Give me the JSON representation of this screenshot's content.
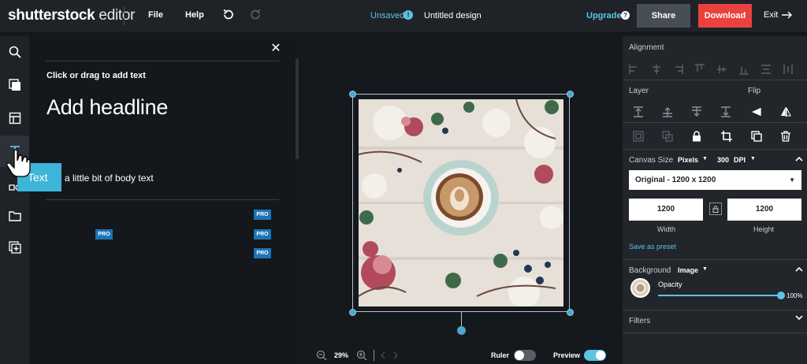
{
  "app": {
    "logo_brand": "shutterstock",
    "logo_product": "editor"
  },
  "topbar": {
    "file_label": "File",
    "help_label": "Help",
    "status_label": "Unsaved",
    "design_name": "Untitled design",
    "upgrade_label": "Upgrade",
    "share_label": "Share",
    "download_label": "Download",
    "exit_label": "Exit"
  },
  "rail": {
    "items": [
      "search-icon",
      "templates-icon",
      "layout-icon",
      "text-icon",
      "elements-icon",
      "folder-icon",
      "add-image-icon"
    ],
    "active": "text-icon"
  },
  "text_panel": {
    "hint": "Click or drag to add text",
    "headline": "Add headline",
    "body": "a little bit of body text",
    "tooltip": "Text",
    "pro_badge": "PRO"
  },
  "canvas": {
    "zoom": "29%",
    "ruler_label": "Ruler",
    "ruler_on": false,
    "preview_label": "Preview",
    "preview_on": true
  },
  "properties": {
    "alignment_title": "Alignment",
    "layer_title": "Layer",
    "flip_title": "Flip",
    "canvas_size_title": "Canvas Size",
    "unit": "Pixels",
    "dpi_value": "300",
    "dpi_label": "DPI",
    "preset": "Original - 1200 x 1200",
    "width_value": "1200",
    "height_value": "1200",
    "width_label": "Width",
    "height_label": "Height",
    "save_preset": "Save as preset",
    "background_title": "Background",
    "background_type": "Image",
    "opacity_label": "Opacity",
    "opacity_value": "100%",
    "filters_title": "Filters"
  },
  "colors": {
    "accent": "#5cc2e6",
    "download": "#e9413e",
    "share": "#484e57",
    "pro": "#1b74b7"
  }
}
